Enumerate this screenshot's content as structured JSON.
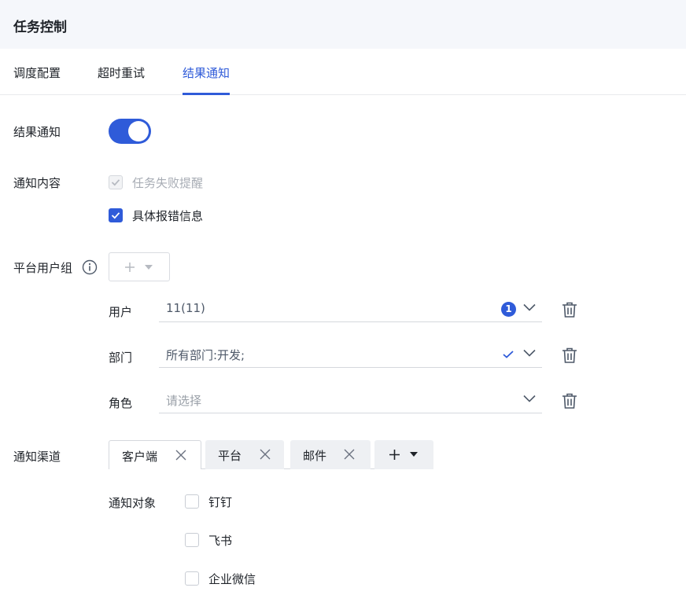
{
  "header": {
    "title": "任务控制"
  },
  "tabs": [
    {
      "label": "调度配置"
    },
    {
      "label": "超时重试"
    },
    {
      "label": "结果通知"
    }
  ],
  "result_notify": {
    "label": "结果通知",
    "enabled": true
  },
  "notify_content": {
    "label": "通知内容",
    "options": [
      {
        "label": "任务失败提醒",
        "checked": true,
        "disabled": true
      },
      {
        "label": "具体报错信息",
        "checked": true,
        "disabled": false
      }
    ]
  },
  "platform_group": {
    "label": "平台用户组",
    "rows": [
      {
        "label": "用户",
        "value": "11(11)",
        "badge": "1"
      },
      {
        "label": "部门",
        "value": "所有部门:开发;"
      },
      {
        "label": "角色",
        "placeholder": "请选择"
      }
    ]
  },
  "channels": {
    "label": "通知渠道",
    "tabs": [
      {
        "label": "客户端"
      },
      {
        "label": "平台"
      },
      {
        "label": "邮件"
      }
    ]
  },
  "notify_target": {
    "label": "通知对象",
    "options": [
      {
        "label": "钉钉"
      },
      {
        "label": "飞书"
      },
      {
        "label": "企业微信"
      }
    ]
  },
  "colors": {
    "accent": "#2f5bd9",
    "header_bg": "#f5f7fb"
  }
}
